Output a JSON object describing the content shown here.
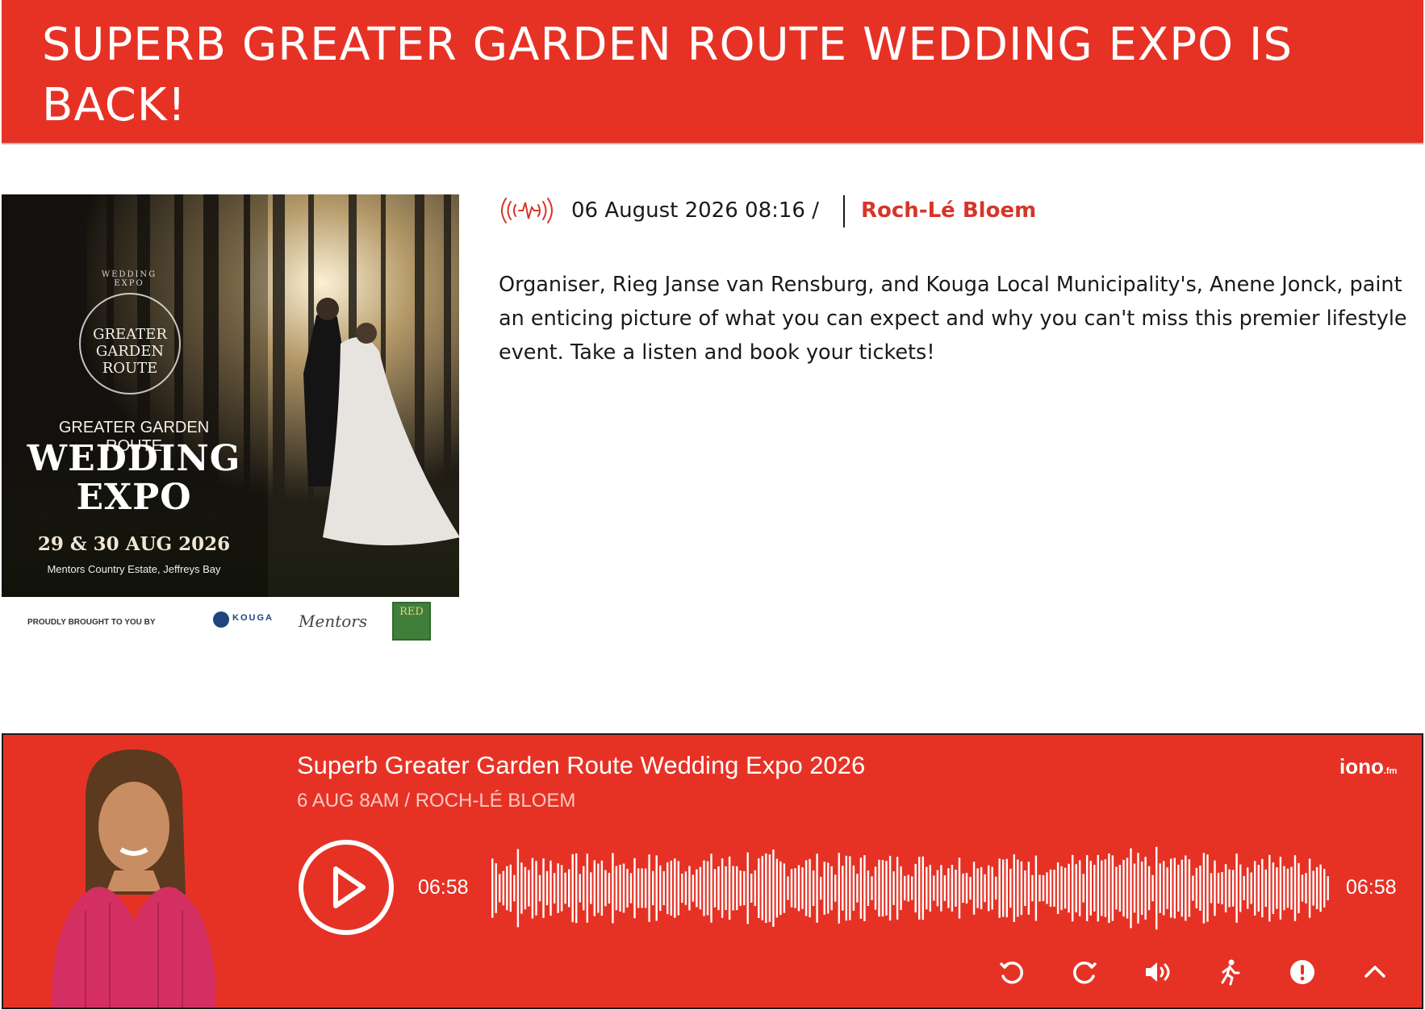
{
  "article": {
    "title": "SUPERB GREATER GARDEN ROUTE WEDDING EXPO IS BACK!",
    "date": "06 August 2026 08:16 /",
    "author": "Roch-Lé Bloem",
    "body": "Organiser, Rieg Janse van Rensburg, and Kouga Local Municipality's, Anene Jonck, paint an enticing picture of what you can expect and why you can't miss this premier lifestyle event. Take a listen and book your tickets!"
  },
  "hero": {
    "logo_ring_text": "WEDDING EXPO",
    "logo_text": "GREATER GARDEN ROUTE",
    "subtitle": "GREATER GARDEN ROUTE",
    "title": "WEDDING EXPO",
    "dates": "29 & 30 AUG 2026",
    "venue": "Mentors Country Estate, Jeffreys Bay",
    "sponsor_label": "PROUDLY BROUGHT TO YOU BY",
    "sponsor_kouga": "KOUGA",
    "sponsor_mentors": "Mentors",
    "sponsor_red": "RED"
  },
  "player": {
    "episode_title": "Superb Greater Garden Route Wedding Expo 2026",
    "episode_meta": "6 AUG 8AM / ROCH-LÉ BLOEM",
    "brand": "iono",
    "brand_suffix": ".fm",
    "time_current": "06:58",
    "time_total": "06:58",
    "controls": [
      "rewind-icon",
      "forward-icon",
      "volume-icon",
      "accessibility-icon",
      "info-icon",
      "chevron-up-icon"
    ]
  },
  "colors": {
    "accent": "#e63225",
    "author": "#d6352a",
    "subtext": "#ffc8c2"
  }
}
